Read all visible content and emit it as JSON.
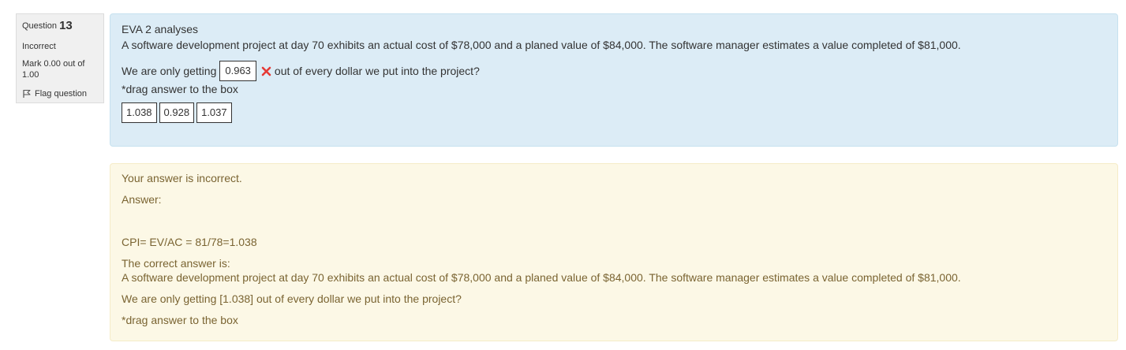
{
  "info": {
    "question_label": "Question",
    "question_number": "13",
    "state": "Incorrect",
    "grade": "Mark 0.00 out of 1.00",
    "flag_label": "Flag question"
  },
  "question": {
    "title": "EVA 2 analyses",
    "text": "A software development project at day 70 exhibits an actual cost of $78,000 and a planed value of $84,000. The software manager estimates a value completed of $81,000.",
    "prefix": "We are only getting",
    "dropped_answer": "0.963",
    "suffix": "out of every dollar we put into the project?",
    "hint": "*drag answer to the box",
    "choices": [
      "1.038",
      "0.928",
      "1.037"
    ]
  },
  "feedback": {
    "status": "Your answer is incorrect.",
    "answer_label": "Answer:",
    "formula": "CPI= EV/AC = 81/78=1.038",
    "correct_label": "The correct answer is:",
    "correct_text": "A software development project at day 70 exhibits an actual cost of $78,000 and a planed value of $84,000. The software manager estimates a value completed of $81,000.",
    "correct_line": "We are only getting [1.038] out of every dollar we put into the project?",
    "hint": "*drag answer to the box"
  },
  "colors": {
    "question_bg": "#dcecf6",
    "feedback_bg": "#fcf8e6",
    "feedback_text": "#7a6432",
    "incorrect_mark": "#e53935"
  },
  "icons": {
    "flag": "flag-icon",
    "incorrect": "cross-icon"
  }
}
